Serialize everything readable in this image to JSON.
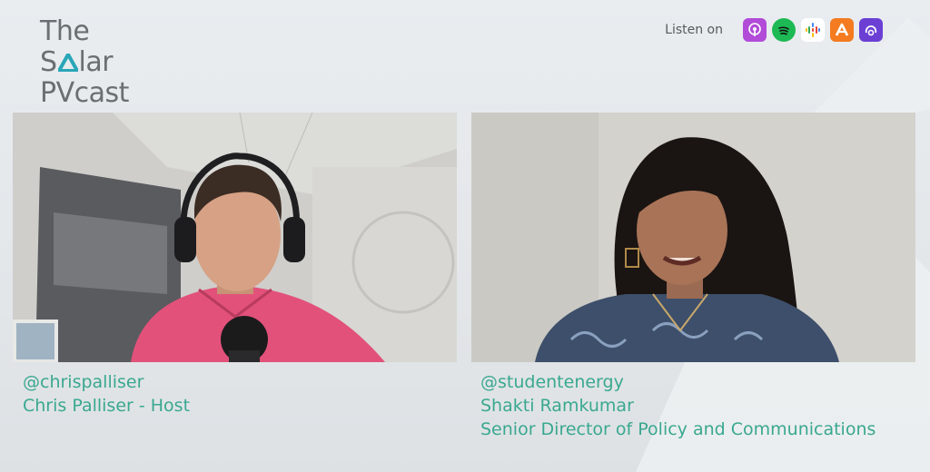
{
  "brand": {
    "line1": "The",
    "line2_left": "S",
    "line2_right": "lar",
    "line3": "PVcast",
    "accent_color": "#29a6b8"
  },
  "listen_on": {
    "label": "Listen on",
    "platforms": [
      {
        "icon": "apple-podcasts-icon",
        "color": "#b14bd8"
      },
      {
        "icon": "spotify-icon",
        "color": "#1db954"
      },
      {
        "icon": "google-podcasts-icon",
        "color": "#ffffff"
      },
      {
        "icon": "audible-icon",
        "color": "#f47b20"
      },
      {
        "icon": "pocket-casts-icon",
        "color": "#6b3fd4"
      }
    ]
  },
  "host": {
    "handle": "@chrispalliser",
    "name": "Chris Palliser - Host"
  },
  "guest": {
    "handle": "@studentenergy",
    "name": "Shakti Ramkumar",
    "title": "Senior Director of Policy and Communications"
  },
  "caption_color": "#3aa890"
}
